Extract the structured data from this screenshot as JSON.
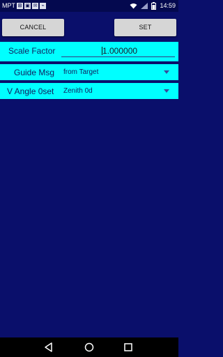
{
  "status_bar": {
    "carrier": "MPT",
    "icons": [
      "sim-icon",
      "image-icon",
      "mail-icon",
      "cast-icon"
    ],
    "time": "14:59"
  },
  "toolbar": {
    "cancel_label": "CANCEL",
    "set_label": "SET"
  },
  "fields": {
    "scale_factor_label": "Scale Factor",
    "scale_factor_value": "1.000000",
    "guide_msg_label": "Guide Msg",
    "guide_msg_value": "from Target",
    "v_angle_label": "V Angle 0set",
    "v_angle_value": "Zenith 0d"
  },
  "colors": {
    "background": "#0a0f6b",
    "field_row": "#00ffff",
    "button": "#d6d6d6"
  }
}
